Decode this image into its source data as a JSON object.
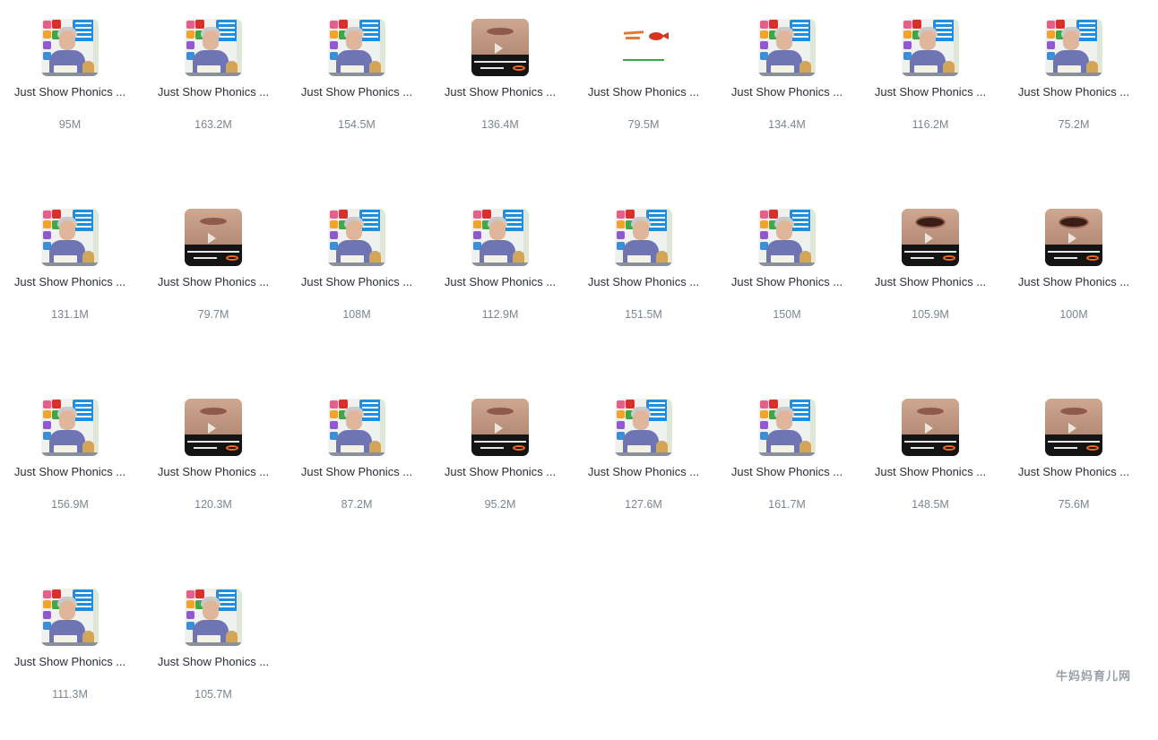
{
  "files": [
    {
      "name": "Just Show Phonics ...",
      "size": "95M",
      "thumb": "presenter"
    },
    {
      "name": "Just Show Phonics ...",
      "size": "163.2M",
      "thumb": "presenter"
    },
    {
      "name": "Just Show Phonics ...",
      "size": "154.5M",
      "thumb": "presenter"
    },
    {
      "name": "Just Show Phonics ...",
      "size": "136.4M",
      "thumb": "mouth"
    },
    {
      "name": "Just Show Phonics ...",
      "size": "79.5M",
      "thumb": "fish"
    },
    {
      "name": "Just Show Phonics ...",
      "size": "134.4M",
      "thumb": "presenter"
    },
    {
      "name": "Just Show Phonics ...",
      "size": "116.2M",
      "thumb": "presenter"
    },
    {
      "name": "Just Show Phonics ...",
      "size": "75.2M",
      "thumb": "presenter"
    },
    {
      "name": "Just Show Phonics ...",
      "size": "131.1M",
      "thumb": "presenter"
    },
    {
      "name": "Just Show Phonics ...",
      "size": "79.7M",
      "thumb": "mouth"
    },
    {
      "name": "Just Show Phonics ...",
      "size": "108M",
      "thumb": "presenter"
    },
    {
      "name": "Just Show Phonics ...",
      "size": "112.9M",
      "thumb": "presenter"
    },
    {
      "name": "Just Show Phonics ...",
      "size": "151.5M",
      "thumb": "presenter"
    },
    {
      "name": "Just Show Phonics ...",
      "size": "150M",
      "thumb": "presenter"
    },
    {
      "name": "Just Show Phonics ...",
      "size": "105.9M",
      "thumb": "mouth-open"
    },
    {
      "name": "Just Show Phonics ...",
      "size": "100M",
      "thumb": "mouth-open"
    },
    {
      "name": "Just Show Phonics ...",
      "size": "156.9M",
      "thumb": "presenter"
    },
    {
      "name": "Just Show Phonics ...",
      "size": "120.3M",
      "thumb": "mouth"
    },
    {
      "name": "Just Show Phonics ...",
      "size": "87.2M",
      "thumb": "presenter"
    },
    {
      "name": "Just Show Phonics ...",
      "size": "95.2M",
      "thumb": "mouth"
    },
    {
      "name": "Just Show Phonics ...",
      "size": "127.6M",
      "thumb": "presenter"
    },
    {
      "name": "Just Show Phonics ...",
      "size": "161.7M",
      "thumb": "presenter"
    },
    {
      "name": "Just Show Phonics ...",
      "size": "148.5M",
      "thumb": "mouth"
    },
    {
      "name": "Just Show Phonics ...",
      "size": "75.6M",
      "thumb": "mouth"
    },
    {
      "name": "Just Show Phonics ...",
      "size": "111.3M",
      "thumb": "presenter"
    },
    {
      "name": "Just Show Phonics ...",
      "size": "105.7M",
      "thumb": "presenter"
    }
  ],
  "watermark": "牛妈妈育儿网"
}
